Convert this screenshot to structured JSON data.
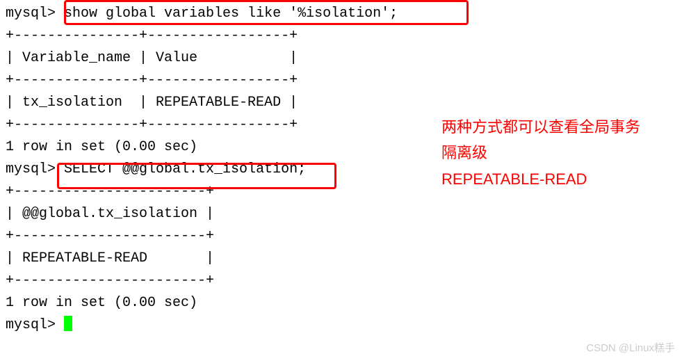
{
  "terminal": {
    "prompt": "mysql>",
    "command1": " show global variables like '%isolation';",
    "sep1_top": "+---------------+-----------------+",
    "header1": "| Variable_name | Value           |",
    "sep1_mid": "+---------------+-----------------+",
    "row1": "| tx_isolation  | REPEATABLE-READ |",
    "sep1_bot": "+---------------+-----------------+",
    "result1": "1 row in set (0.00 sec)",
    "blank": "",
    "command2": " SELECT @@global.tx_isolation;",
    "sep2_top": "+-----------------------+",
    "header2": "| @@global.tx_isolation |",
    "sep2_mid": "+-----------------------+",
    "row2": "| REPEATABLE-READ       |",
    "sep2_bot": "+-----------------------+",
    "result2": "1 row in set (0.00 sec)",
    "cursor_prompt": "mysql> "
  },
  "annotation": {
    "line1": "两种方式都可以查看全局事务",
    "line2": "隔离级",
    "line3": "REPEATABLE-READ"
  },
  "watermark": "CSDN @Linux糕手"
}
